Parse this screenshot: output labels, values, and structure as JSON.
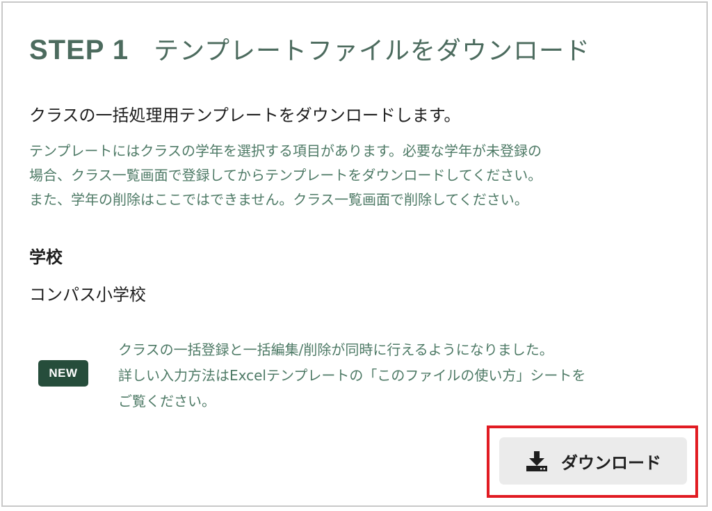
{
  "header": {
    "step": "STEP 1",
    "title": "テンプレートファイルをダウンロード"
  },
  "lead": "クラスの一括処理用テンプレートをダウンロードします。",
  "note_lines": [
    "テンプレートにはクラスの学年を選択する項目があります。必要な学年が未登録の",
    "場合、クラス一覧画面で登録してからテンプレートをダウンロードしてください。",
    "また、学年の削除はここではできません。クラス一覧画面で削除してください。"
  ],
  "school": {
    "label": "学校",
    "name": "コンパス小学校"
  },
  "news": {
    "badge": "NEW",
    "lines": [
      "クラスの一括登録と一括編集/削除が同時に行えるようになりました。",
      "詳しい入力方法はExcelテンプレートの「このファイルの使い方」シートを",
      "ご覧ください。"
    ]
  },
  "download_button": {
    "label": "ダウンロード",
    "icon": "download-icon"
  },
  "colors": {
    "accent_green": "#4c6b5e",
    "note_green": "#4e7a66",
    "badge_bg": "#264d3b",
    "highlight_red": "#e11b22",
    "button_bg": "#ebebeb"
  }
}
